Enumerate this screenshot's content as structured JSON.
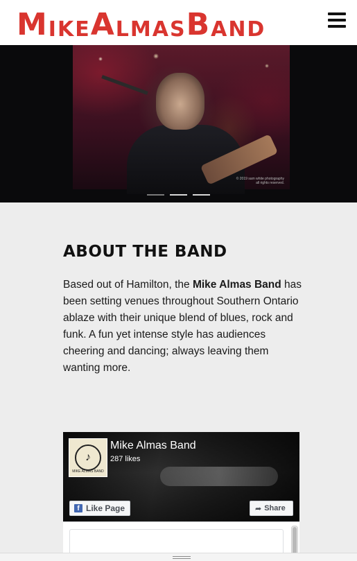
{
  "header": {
    "logo_text": "Mike Almas Band",
    "menu_icon": "hamburger-menu-icon"
  },
  "slider": {
    "photo_credit": "© 2019 sam white photography\nall rights reserved.",
    "slide_count": 3,
    "active_slide": 2
  },
  "about": {
    "title": "ABOUT THE BAND",
    "text_before": "Based out of Hamilton, the ",
    "band_name": "Mike Almas Band",
    "text_after": " has been setting venues throughout Southern Ontario ablaze with their unique blend of blues, rock and funk. A fun yet intense style has audiences cheering and dancing; always leaving them wanting more."
  },
  "facebook": {
    "page_name": "Mike Almas Band",
    "likes": "287 likes",
    "like_button": "Like Page",
    "share_button": "Share",
    "avatar_caption": "MIKE ALMAS BAND"
  },
  "colors": {
    "brand_red": "#d9352f",
    "page_bg": "#ededed",
    "fb_blue": "#4267b2"
  }
}
